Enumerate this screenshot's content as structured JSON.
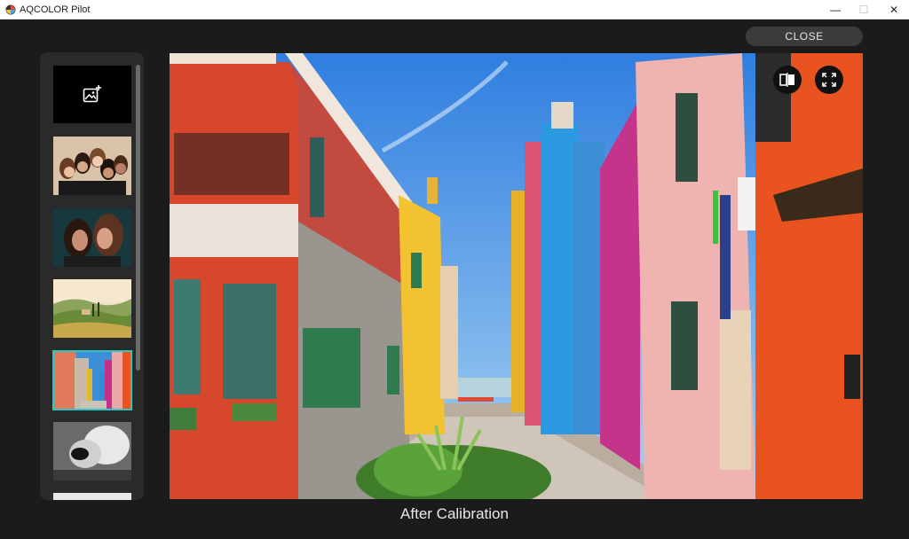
{
  "window": {
    "title": "AQCOLOR Pilot",
    "minimize_glyph": "—",
    "maximize_glyph": "☐",
    "close_glyph": "✕"
  },
  "toolbar": {
    "close_label": "CLOSE"
  },
  "sidebar": {
    "add_tile_icon": "add-image-icon",
    "thumbnails": [
      {
        "subject": "group-portrait"
      },
      {
        "subject": "two-portraits"
      },
      {
        "subject": "landscape-hills"
      },
      {
        "subject": "colorful-street",
        "selected": true
      },
      {
        "subject": "bw-portrait"
      },
      {
        "subject": "partial-thumbnail"
      }
    ],
    "selected_accent": "#2cc7c2"
  },
  "viewer": {
    "caption": "After Calibration",
    "buttons": [
      "compare-icon",
      "fullscreen-icon"
    ]
  },
  "colors": {
    "background": "#1b1b1b",
    "panel": "#2a2a2a",
    "button": "#3b3b3b"
  }
}
